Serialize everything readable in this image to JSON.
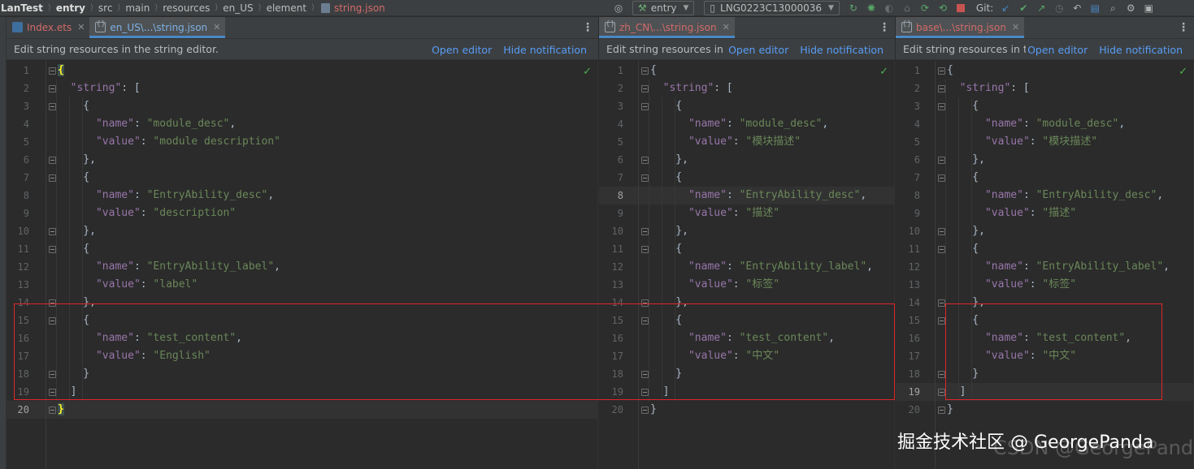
{
  "breadcrumb": [
    "LanTest",
    "entry",
    "src",
    "main",
    "resources",
    "en_US",
    "element",
    "string.json"
  ],
  "toolbar": {
    "run_config": "entry",
    "device": "LNG0223C13000036",
    "git_label": "Git:"
  },
  "notification": {
    "text": "Edit string resources in the string editor.",
    "text_truncated": "Edit string resources in t...",
    "open_editor": "Open editor",
    "hide": "Hide notification"
  },
  "panes": [
    {
      "tabs": [
        {
          "label": "Index.ets",
          "icon": "ets-file-icon",
          "active": false,
          "color": "red"
        },
        {
          "label": "en_US\\...\\string.json",
          "icon": "json-file-icon",
          "active": true,
          "color": "blue"
        }
      ],
      "values": {
        "module_desc": "module description",
        "EntryAbility_desc": "description",
        "EntryAbility_label": "label",
        "test_content": "English"
      }
    },
    {
      "tabs": [
        {
          "label": "zh_CN\\...\\string.json",
          "icon": "json-file-icon",
          "active": true,
          "color": "red"
        }
      ],
      "values": {
        "module_desc": "模块描述",
        "EntryAbility_desc": "描述",
        "EntryAbility_label": "标签",
        "test_content": "中文"
      }
    },
    {
      "tabs": [
        {
          "label": "base\\...\\string.json",
          "icon": "json-file-icon",
          "active": true,
          "color": "red"
        }
      ],
      "values": {
        "module_desc": "模块描述",
        "EntryAbility_desc": "描述",
        "EntryAbility_label": "标签",
        "test_content": "中文"
      }
    }
  ],
  "code": {
    "root_key": "string",
    "name_key": "name",
    "value_key": "value",
    "names": [
      "module_desc",
      "EntryAbility_desc",
      "EntryAbility_label",
      "test_content"
    ],
    "line_numbers": [
      "1",
      "2",
      "3",
      "4",
      "5",
      "6",
      "7",
      "8",
      "9",
      "10",
      "11",
      "12",
      "13",
      "14",
      "15",
      "16",
      "17",
      "18",
      "19",
      "20"
    ]
  },
  "watermark": {
    "primary": "掘金技术社区 @ GeorgePanda",
    "secondary": "CSDN @GeorgePanda"
  },
  "colors": {
    "keyword": "#9876aa",
    "string": "#6a8759",
    "link": "#589df6",
    "highlight_box": "#e0262b"
  }
}
